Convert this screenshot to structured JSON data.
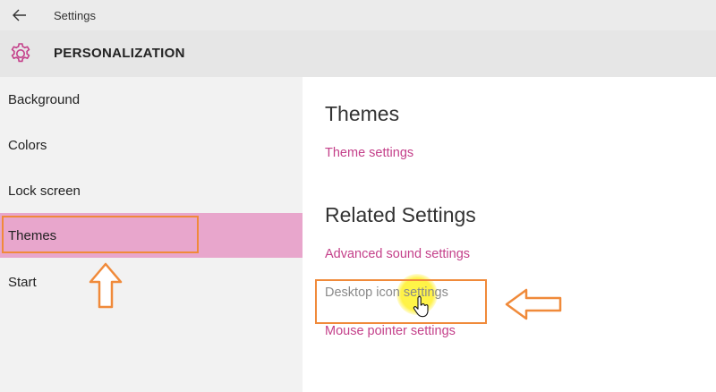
{
  "window": {
    "title": "Settings"
  },
  "header": {
    "title": "PERSONALIZATION",
    "accent": "#c4408a"
  },
  "sidebar": {
    "items": [
      {
        "label": "Background",
        "selected": false
      },
      {
        "label": "Colors",
        "selected": false
      },
      {
        "label": "Lock screen",
        "selected": false
      },
      {
        "label": "Themes",
        "selected": true
      },
      {
        "label": "Start",
        "selected": false
      }
    ]
  },
  "main": {
    "themes_heading": "Themes",
    "theme_settings_link": "Theme settings",
    "related_heading": "Related Settings",
    "related_links": [
      "Advanced sound settings",
      "Desktop icon settings",
      "Mouse pointer settings"
    ]
  },
  "annotations": {
    "highlight_color": "#f08a3a",
    "selected_color": "#e8a6cc"
  }
}
